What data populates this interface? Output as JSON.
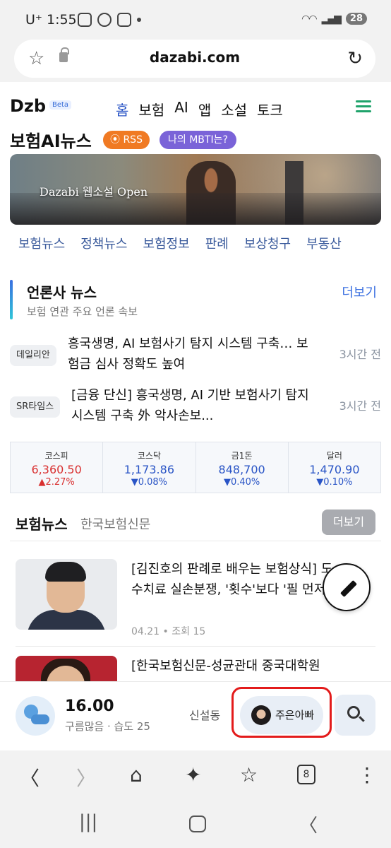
{
  "status": {
    "time": "U⁺ 1:55",
    "battery": "28"
  },
  "browser": {
    "url": "dazabi.com",
    "tab_count": "8"
  },
  "site": {
    "logo": "Dzb",
    "beta": "Beta",
    "nav": [
      "홈",
      "보험",
      "AI",
      "앱",
      "소설",
      "토크"
    ],
    "title": "보험AI뉴스",
    "rss": "RSS",
    "mbti": "나의 MBTI는?",
    "banner_text": "Dazabi 웹소설 Open",
    "subnav": [
      "보험뉴스",
      "정책뉴스",
      "보험정보",
      "판례",
      "보상청구",
      "부동산"
    ]
  },
  "press": {
    "title": "언론사 뉴스",
    "subtitle": "보험 연관 주요 언론 속보",
    "more": "더보기",
    "items": [
      {
        "source": "데일리안",
        "headline": "흥국생명, AI 보험사기 탐지 시스템 구축… 보험금 심사 정확도 높여",
        "ago": "3시간 전"
      },
      {
        "source": "SR타임스",
        "headline": "[금융 단신] 흥국생명, AI 기반 보험사기 탐지 시스템 구축 外 악사손보...",
        "ago": "3시간 전"
      }
    ]
  },
  "market": [
    {
      "name": "코스피",
      "value": "6,360.50",
      "change": "▲2.27%",
      "dir": "up"
    },
    {
      "name": "코스닥",
      "value": "1,173.86",
      "change": "▼0.08%",
      "dir": "down"
    },
    {
      "name": "금1돈",
      "value": "848,700",
      "change": "▼0.40%",
      "dir": "down"
    },
    {
      "name": "달러",
      "value": "1,470.90",
      "change": "▼0.10%",
      "dir": "down"
    }
  ],
  "insurance_news": {
    "title": "보험뉴스",
    "source": "한국보험신문",
    "more": "더보기",
    "articles": [
      {
        "headline": "[김진호의 판례로 배우는 보험상식] 도수치료 실손분쟁, '횟수'보다 '필 먼저",
        "meta": "04.21 • 조회 15"
      },
      {
        "headline": "[한국보험신문-성균관대 중국대학원"
      }
    ]
  },
  "infobar": {
    "temperature": "16.00",
    "weather": "구름많음 · 습도 25",
    "location": "신설동",
    "user": "주은아빠"
  },
  "colors": {
    "accent": "#2a55c6",
    "rss": "#f07a23",
    "mbti": "#7a63d8",
    "highlight": "#e31b1b",
    "up": "#d93030",
    "down": "#2a55c6"
  }
}
